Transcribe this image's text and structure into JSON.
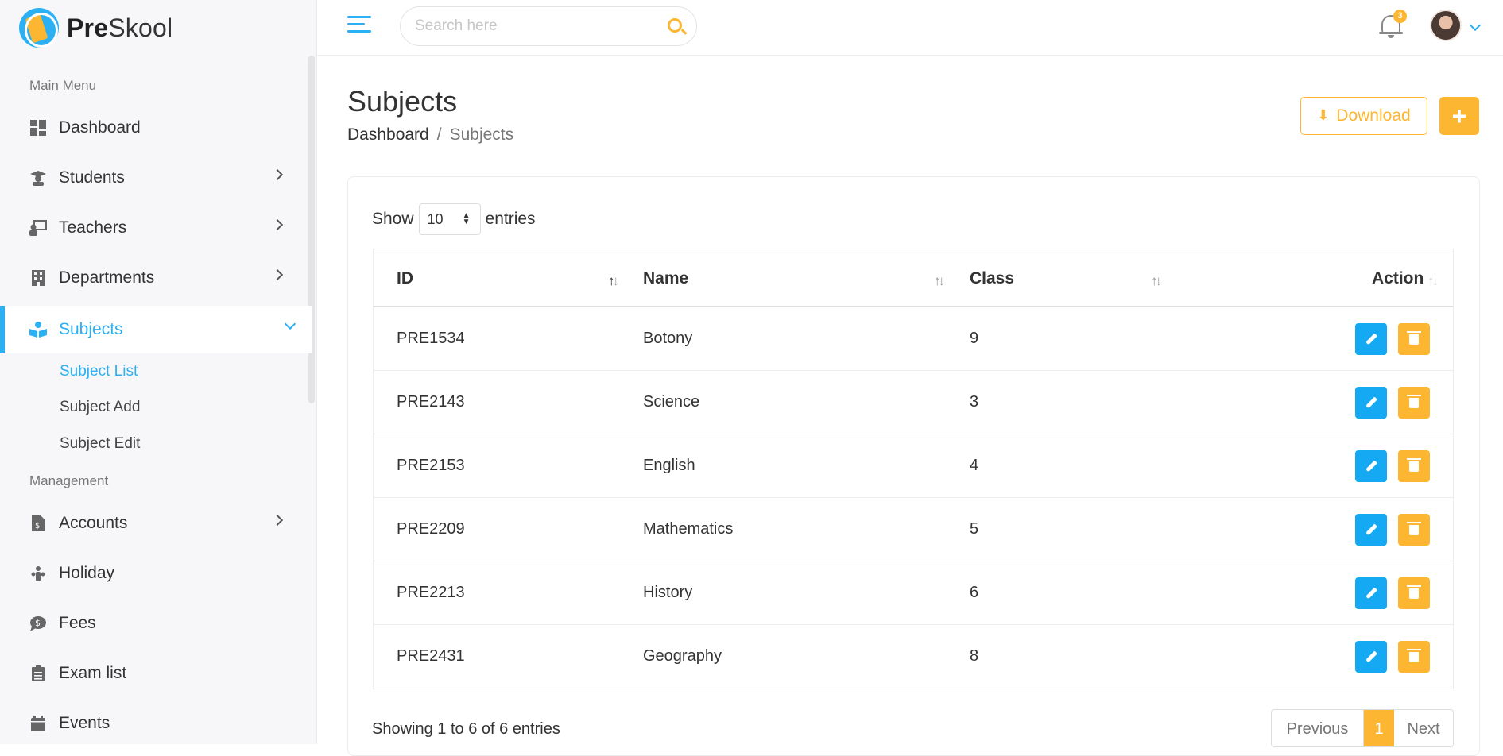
{
  "brand": {
    "name_bold": "Pre",
    "name_rest": "Skool"
  },
  "colors": {
    "accent_blue": "#2ab0f3",
    "accent_orange": "#fcb632"
  },
  "sidebar": {
    "main_menu_title": "Main Menu",
    "management_title": "Management",
    "items": [
      {
        "label": "Dashboard",
        "icon": "dashboard-icon"
      },
      {
        "label": "Students",
        "icon": "student-icon"
      },
      {
        "label": "Teachers",
        "icon": "teacher-icon"
      },
      {
        "label": "Departments",
        "icon": "building-icon"
      },
      {
        "label": "Subjects",
        "icon": "book-reader-icon"
      }
    ],
    "sub_items": [
      {
        "label": "Subject List"
      },
      {
        "label": "Subject Add"
      },
      {
        "label": "Subject Edit"
      }
    ],
    "management_items": [
      {
        "label": "Accounts",
        "icon": "file-invoice-dollar-icon"
      },
      {
        "label": "Holiday",
        "icon": "holiday-icon"
      },
      {
        "label": "Fees",
        "icon": "dollar-comment-icon"
      },
      {
        "label": "Exam list",
        "icon": "clipboard-list-icon"
      },
      {
        "label": "Events",
        "icon": "calendar-icon"
      }
    ]
  },
  "header": {
    "search_placeholder": "Search here",
    "notification_count": "3"
  },
  "page": {
    "title": "Subjects",
    "breadcrumb_root": "Dashboard",
    "breadcrumb_separator": "/",
    "breadcrumb_current": "Subjects",
    "download_label": "Download",
    "add_label": "+"
  },
  "table": {
    "show_label": "Show",
    "entries_label": "entries",
    "page_size": "10",
    "columns": {
      "id": "ID",
      "name": "Name",
      "class": "Class",
      "action": "Action"
    },
    "rows": [
      {
        "id": "PRE1534",
        "name": "Botony",
        "class": "9"
      },
      {
        "id": "PRE2143",
        "name": "Science",
        "class": "3"
      },
      {
        "id": "PRE2153",
        "name": "English",
        "class": "4"
      },
      {
        "id": "PRE2209",
        "name": "Mathematics",
        "class": "5"
      },
      {
        "id": "PRE2213",
        "name": "History",
        "class": "6"
      },
      {
        "id": "PRE2431",
        "name": "Geography",
        "class": "8"
      }
    ],
    "info": "Showing 1 to 6 of 6 entries",
    "pagination": {
      "previous": "Previous",
      "current": "1",
      "next": "Next"
    }
  }
}
